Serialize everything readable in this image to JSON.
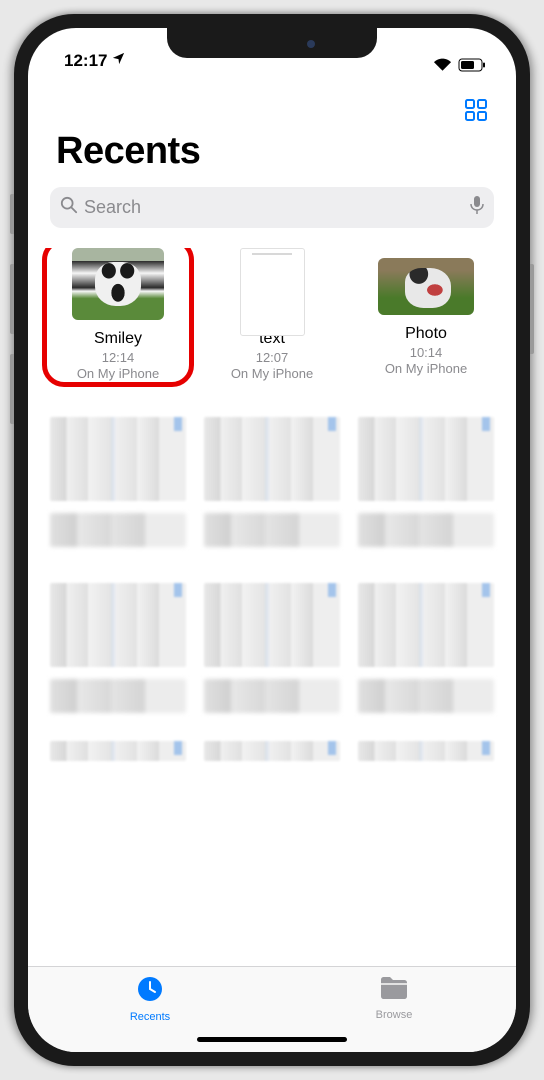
{
  "status": {
    "time": "12:17"
  },
  "header": {
    "title": "Recents"
  },
  "search": {
    "placeholder": "Search"
  },
  "items": [
    {
      "name": "Smiley",
      "time": "12:14",
      "location": "On My iPhone",
      "highlighted": true
    },
    {
      "name": "text",
      "time": "12:07",
      "location": "On My iPhone"
    },
    {
      "name": "Photo",
      "time": "10:14",
      "location": "On My iPhone"
    }
  ],
  "tabs": {
    "recents": "Recents",
    "browse": "Browse"
  }
}
